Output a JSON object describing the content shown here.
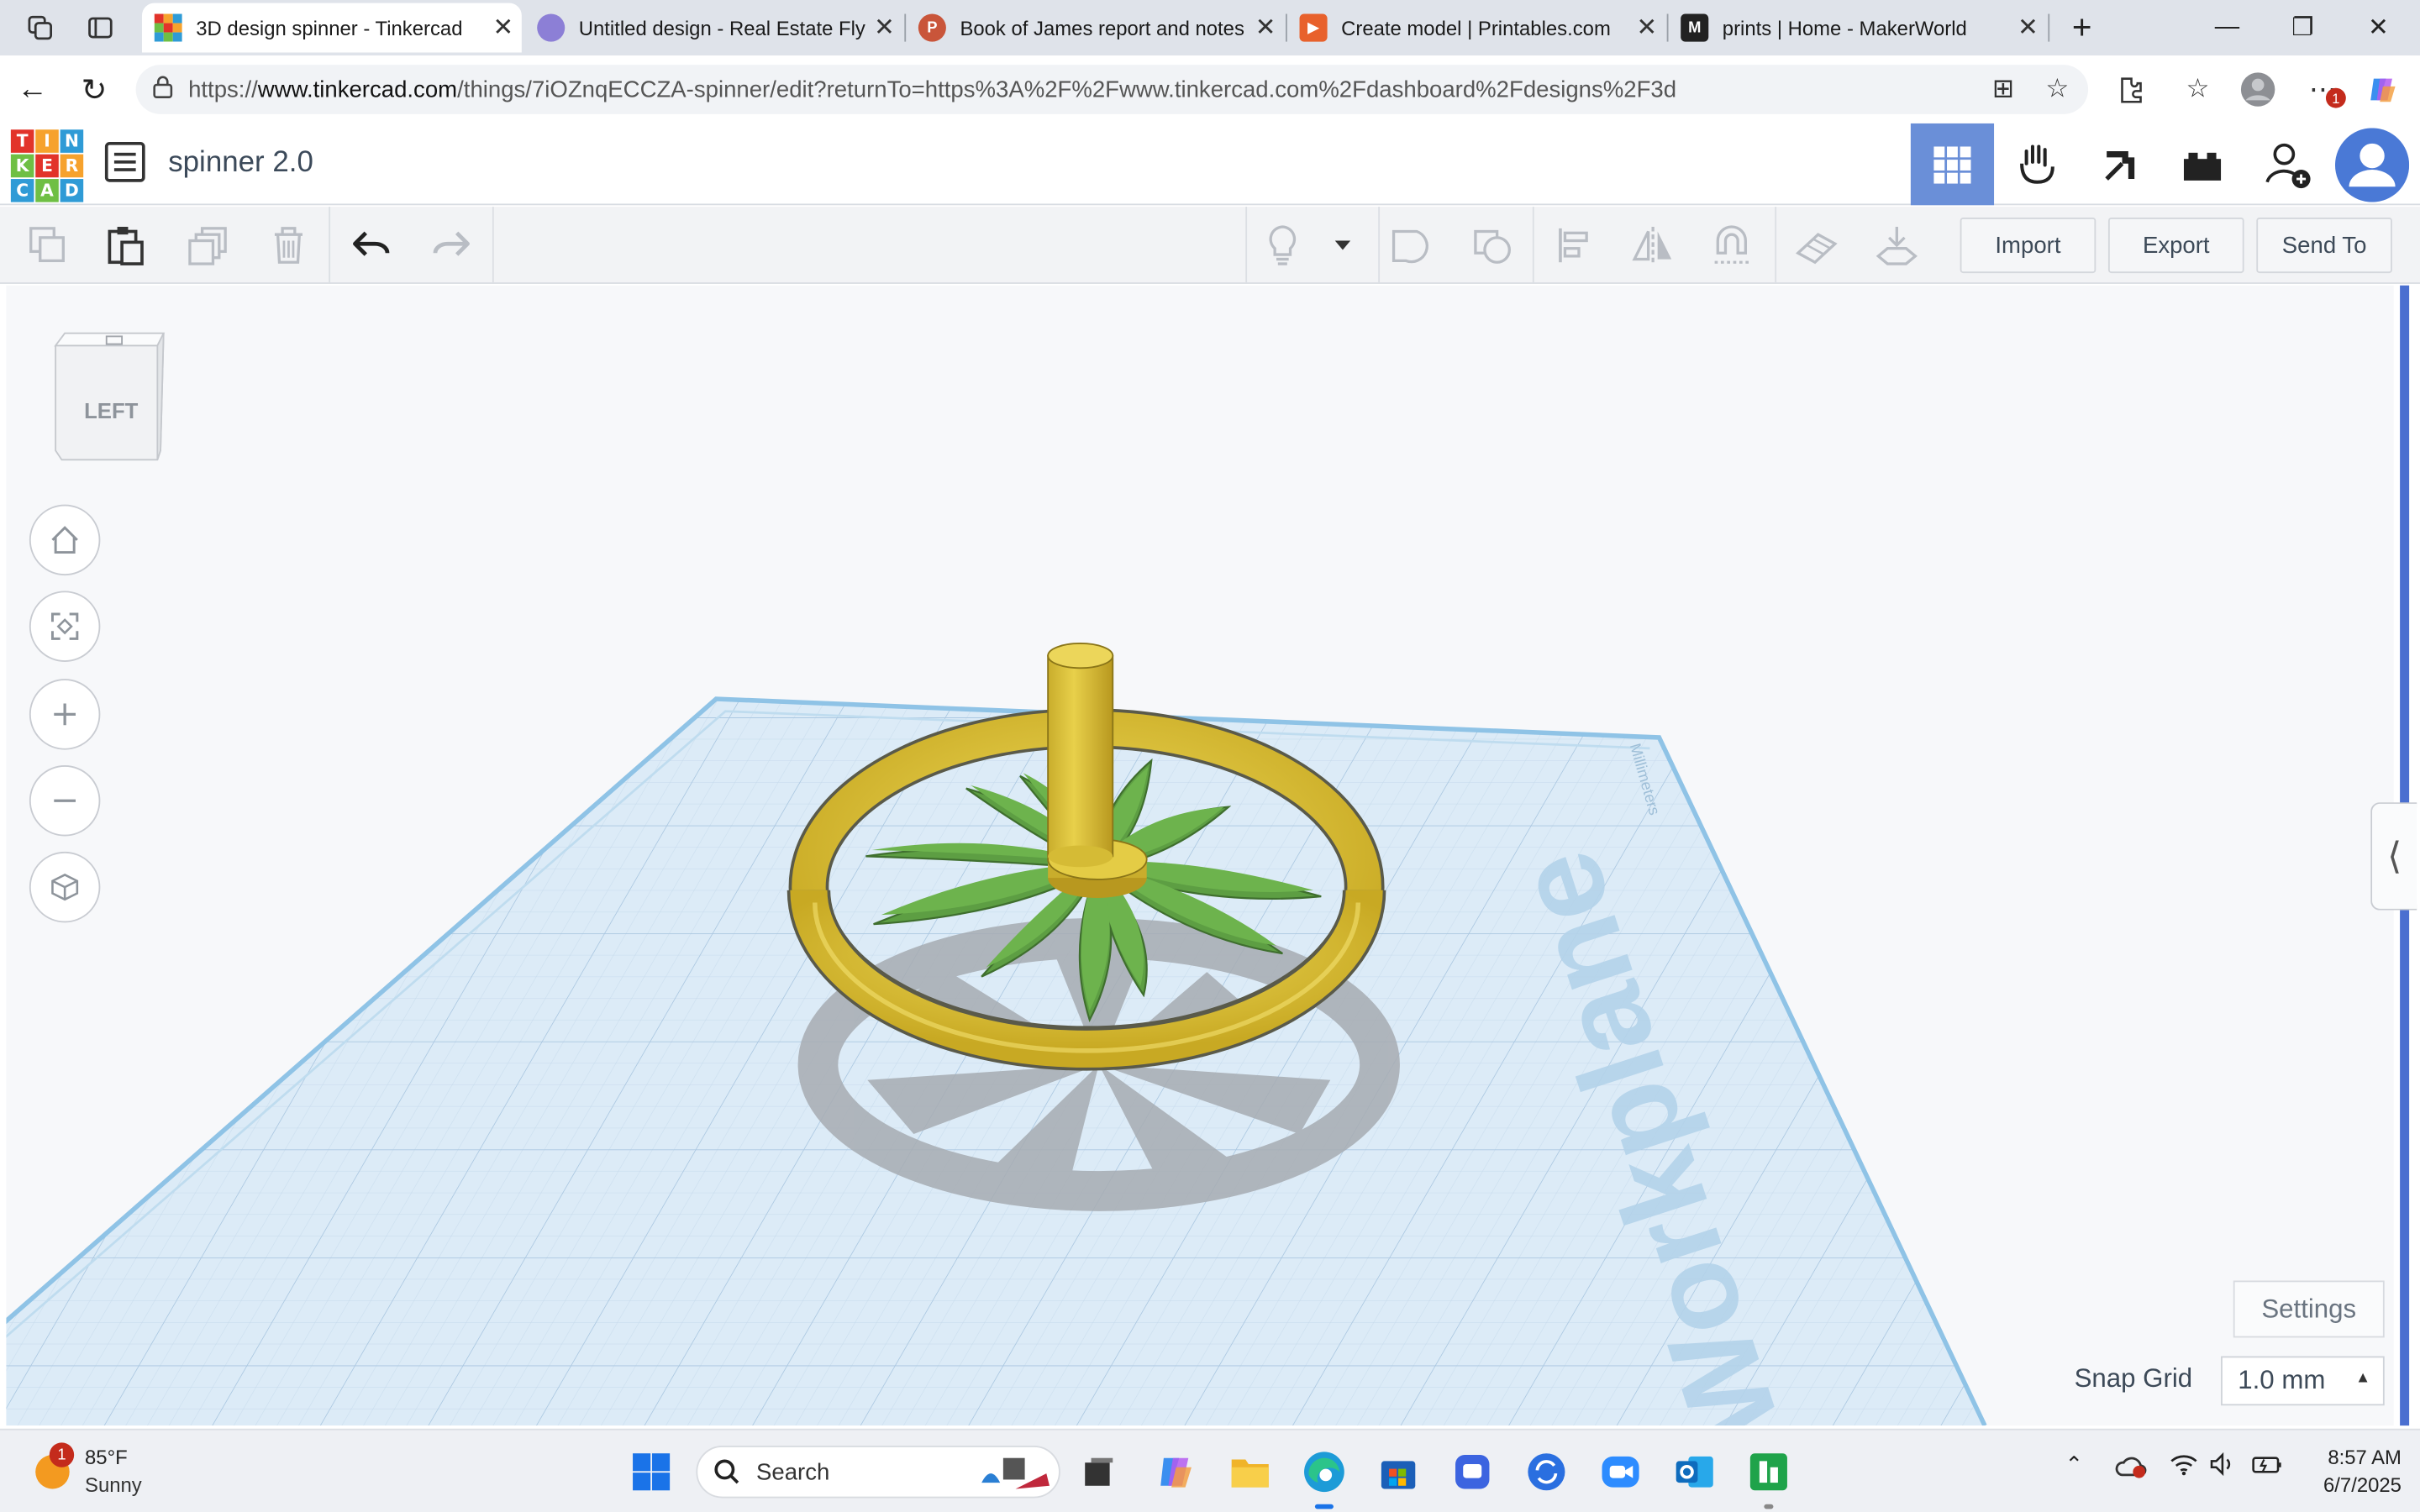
{
  "browser": {
    "tabs": [
      {
        "title": "3D design spinner - Tinkercad",
        "active": true
      },
      {
        "title": "Untitled design - Real Estate Fly",
        "active": false
      },
      {
        "title": "Book of James report and notes",
        "active": false
      },
      {
        "title": "Create model | Printables.com",
        "active": false
      },
      {
        "title": "prints | Home - MakerWorld",
        "active": false
      }
    ],
    "url_prefix": "https://",
    "url_domain": "www.tinkercad.com",
    "url_path": "/things/7iOZnqECCZA-spinner/edit?returnTo=https%3A%2F%2Fwww.tinkercad.com%2Fdashboard%2Fdesigns%2F3d",
    "profile_badge": "1"
  },
  "app": {
    "logo_letters": [
      "T",
      "I",
      "N",
      "K",
      "E",
      "R",
      "C",
      "A",
      "D"
    ],
    "logo_colors": [
      "#e2332a",
      "#f6a22d",
      "#2f9bd6",
      "#6fbf44",
      "#e2332a",
      "#f6a22d",
      "#2f9bd6",
      "#6fbf44",
      "#2f9bd6"
    ],
    "design_title": "spinner 2.0",
    "accent": "#6a8fd8"
  },
  "toolbar": {
    "import_label": "Import",
    "export_label": "Export",
    "send_to_label": "Send To"
  },
  "viewport": {
    "view_cube_face": "LEFT",
    "workplane_label": "Workplane",
    "units_label": "Millimeters",
    "settings_label": "Settings",
    "snap_grid_label": "Snap Grid",
    "snap_grid_value": "1.0 mm",
    "ring_color": "#e6c93b",
    "petal_color": "#6db34d",
    "workplane_color": "#dbeaf6"
  },
  "taskbar": {
    "weather_temp": "85°F",
    "weather_desc": "Sunny",
    "weather_badge": "1",
    "search_placeholder": "Search",
    "time": "8:57 AM",
    "date": "6/7/2025"
  }
}
